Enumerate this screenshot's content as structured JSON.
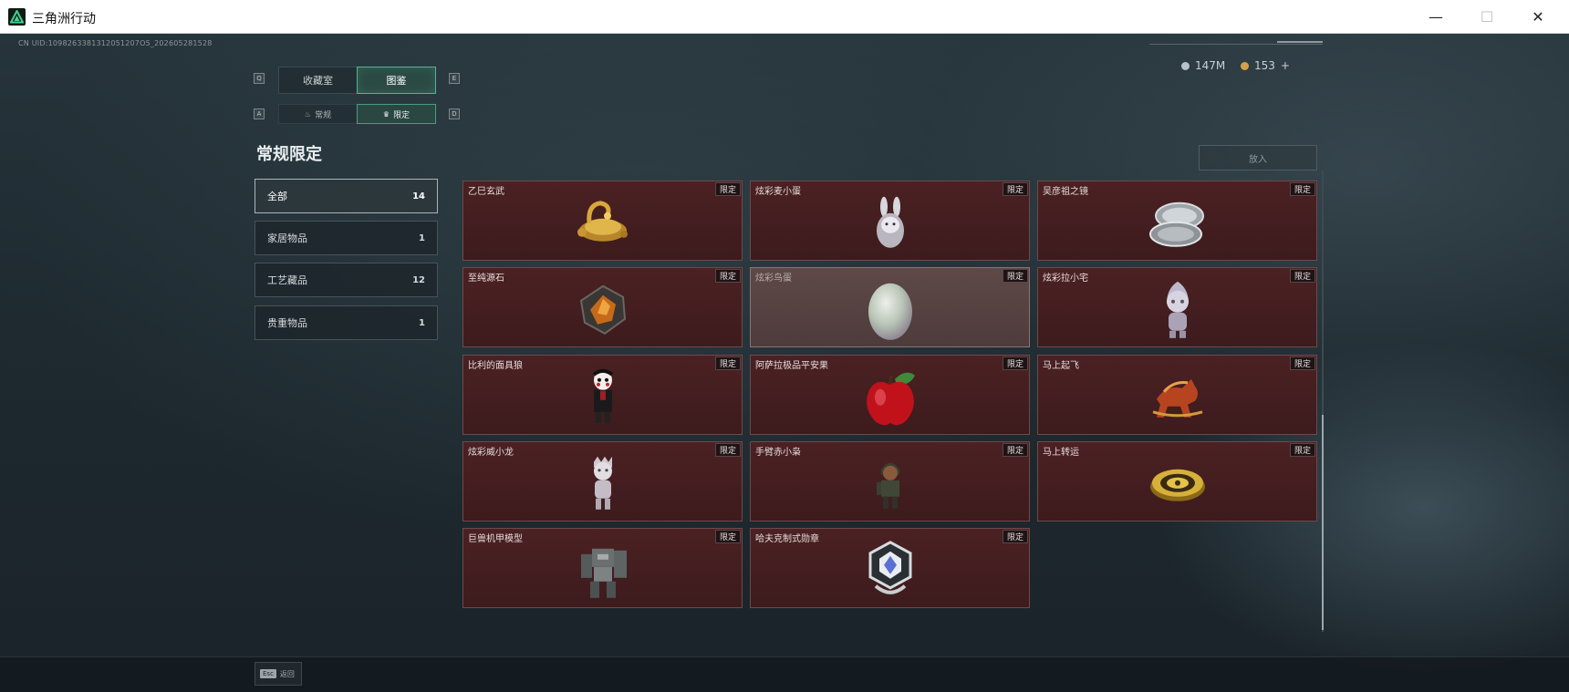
{
  "window": {
    "title": "三角洲行动",
    "controls": {
      "minimize": "—",
      "maximize": "☐",
      "close": "✕"
    }
  },
  "hud": {
    "uid": "CN UID:1098263381312051207O5_202605281528",
    "currencies": [
      {
        "icon": "coin-silver-icon",
        "value": "147M",
        "color": "#b9c2c6"
      },
      {
        "icon": "coin-gold-icon",
        "value": "153",
        "color": "#d4a04a",
        "add": "+"
      }
    ]
  },
  "key_hints": {
    "left_top": "Q",
    "right_top": "E",
    "left_sub": "A",
    "right_sub": "D"
  },
  "tabs": [
    {
      "label": "收藏室",
      "active": false
    },
    {
      "label": "图鉴",
      "active": true
    }
  ],
  "sub_tabs": [
    {
      "label": "常规",
      "icon": "flame-icon",
      "active": false
    },
    {
      "label": "限定",
      "icon": "crown-icon",
      "active": true
    }
  ],
  "section_title": "常规限定",
  "categories": [
    {
      "label": "全部",
      "count": "14",
      "active": true
    },
    {
      "label": "家居物品",
      "count": "1",
      "active": false
    },
    {
      "label": "工艺藏品",
      "count": "12",
      "active": false
    },
    {
      "label": "贵重物品",
      "count": "1",
      "active": false
    }
  ],
  "put_in_button": "放入",
  "items": [
    {
      "name": "乙巳玄武",
      "tag": "限定",
      "icon": "golden-turtle-icon"
    },
    {
      "name": "炫彩麦小蛋",
      "tag": "限定",
      "icon": "bunny-egg-icon"
    },
    {
      "name": "吴彦祖之镜",
      "tag": "限定",
      "icon": "compact-mirror-icon"
    },
    {
      "name": "至纯源石",
      "tag": "限定",
      "icon": "crystal-stone-icon"
    },
    {
      "name": "炫彩鸟蛋",
      "tag": "限定",
      "icon": "iridescent-egg-icon"
    },
    {
      "name": "炫彩拉小宅",
      "tag": "限定",
      "icon": "hooded-figure-icon"
    },
    {
      "name": "比利的面具狼",
      "tag": "限定",
      "icon": "puppet-doll-icon"
    },
    {
      "name": "阿萨拉极品平安果",
      "tag": "限定",
      "icon": "red-apple-icon"
    },
    {
      "name": "马上起飞",
      "tag": "限定",
      "icon": "flying-horse-icon"
    },
    {
      "name": "炫彩威小龙",
      "tag": "限定",
      "icon": "dragon-figure-icon"
    },
    {
      "name": "手臂赤小枭",
      "tag": "限定",
      "icon": "soldier-figure-icon"
    },
    {
      "name": "马上转运",
      "tag": "限定",
      "icon": "golden-compass-icon"
    },
    {
      "name": "巨兽机甲模型",
      "tag": "限定",
      "icon": "mech-model-icon"
    },
    {
      "name": "哈夫克制式勋章",
      "tag": "限定",
      "icon": "medal-icon"
    }
  ],
  "footer": {
    "esc_key": "Esc",
    "esc_label": "返回"
  }
}
